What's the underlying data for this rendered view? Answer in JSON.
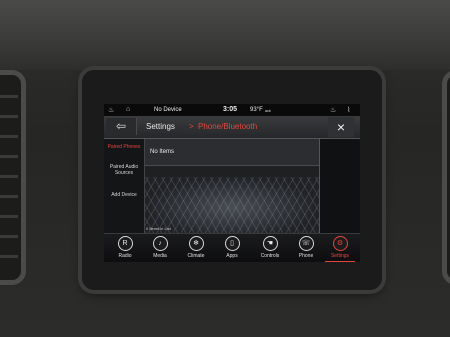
{
  "status_bar": {
    "device": "No Device",
    "time": "3:05",
    "temperature": "93°F",
    "temperature_unit_note": "out"
  },
  "title_bar": {
    "back_icon": "back-arrow-icon",
    "crumb_root": "Settings",
    "crumb_sep": ">",
    "crumb_current": "Phone/Bluetooth",
    "close_icon": "×"
  },
  "sidebar": {
    "items": [
      {
        "label": "Paired Phones",
        "active": true
      },
      {
        "label": "Paired Audio Sources",
        "active": false
      },
      {
        "label": "Add Device",
        "active": false
      }
    ]
  },
  "content": {
    "list_message": "No Items",
    "items_count_note": "0 Items in List"
  },
  "nav": {
    "items": [
      {
        "label": "Radio",
        "icon": "radio-icon",
        "glyph": "R"
      },
      {
        "label": "Media",
        "icon": "media-icon",
        "glyph": "♪"
      },
      {
        "label": "Climate",
        "icon": "climate-icon",
        "glyph": "❄"
      },
      {
        "label": "Apps",
        "icon": "apps-icon",
        "glyph": "▯"
      },
      {
        "label": "Controls",
        "icon": "controls-icon",
        "glyph": "☚"
      },
      {
        "label": "Phone",
        "icon": "phone-icon",
        "glyph": "☏"
      },
      {
        "label": "Settings",
        "icon": "settings-icon",
        "glyph": "⚙",
        "active": true
      }
    ]
  },
  "colors": {
    "accent": "#e2463d",
    "screen_bg": "#0d0e10"
  }
}
